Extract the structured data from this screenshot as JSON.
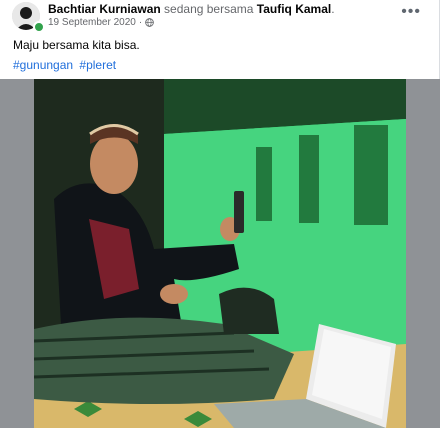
{
  "post": {
    "author": "Bachtiar Kurniawan",
    "with_text": "sedang bersama",
    "tagged": "Taufiq Kamal",
    "period": ".",
    "date": "19 September 2020",
    "separator": "·",
    "privacy_icon": "globe-icon",
    "more_icon": "more-options-icon",
    "more_glyph": "•••",
    "text": "Maju bersama kita bisa.",
    "hashtags": [
      "#gunungan",
      "#pleret"
    ],
    "photo_icon": "photo"
  },
  "colors": {
    "link": "#216fdb",
    "online": "#31a24c",
    "wall": "#3fcf78",
    "secondary_text": "#65676b"
  }
}
